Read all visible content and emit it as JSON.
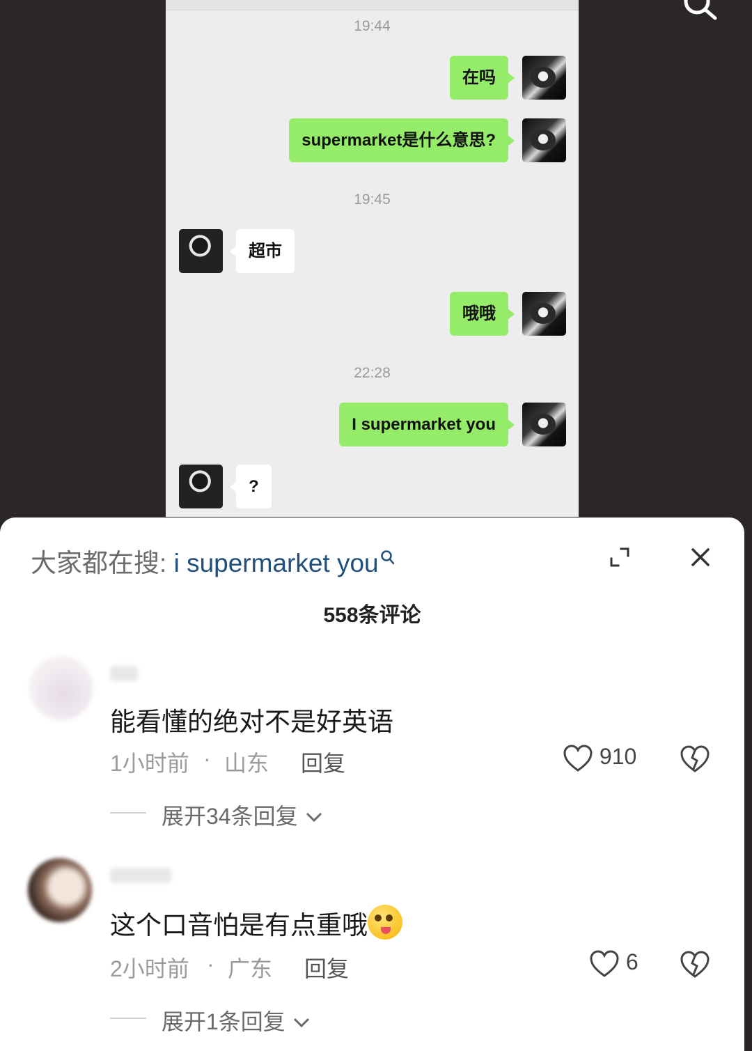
{
  "chat": {
    "timestamps": [
      "19:44",
      "19:45",
      "22:28"
    ],
    "messages": [
      {
        "side": "right",
        "text": "在吗"
      },
      {
        "side": "right",
        "text": "supermarket是什么意思?"
      },
      {
        "side": "left",
        "text": "超市"
      },
      {
        "side": "right",
        "text": "哦哦"
      },
      {
        "side": "right",
        "text": "I supermarket you"
      },
      {
        "side": "left",
        "text": "?"
      }
    ],
    "bubble_green": "#95ec69"
  },
  "panel": {
    "search_prefix": "大家都在搜:",
    "search_query": "i supermarket you",
    "comment_count": "558条评论"
  },
  "comments": [
    {
      "text": "能看懂的绝对不是好英语",
      "time": "1小时前",
      "location": "山东",
      "reply": "回复",
      "likes": "910",
      "expand": "展开34条回复"
    },
    {
      "text": "这个口音怕是有点重哦",
      "emoji": "drooling-face-emoji",
      "time": "2小时前",
      "location": "广东",
      "reply": "回复",
      "likes": "6",
      "expand": "展开1条回复"
    }
  ],
  "icons": {
    "top_search": "search-icon",
    "expand": "expand-icon",
    "close": "close-icon",
    "like": "heart-outline-icon",
    "dislike": "broken-heart-icon",
    "chevron": "chevron-down-icon"
  }
}
